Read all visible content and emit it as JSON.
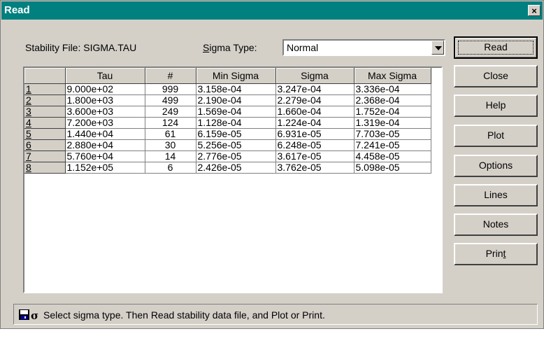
{
  "window": {
    "title": "Read",
    "close_label": "×"
  },
  "stability_file_label": "Stability File: SIGMA.TAU",
  "sigma_type": {
    "label_first": "S",
    "label_rest": "igma Type:",
    "value": "Normal"
  },
  "buttons": [
    {
      "id": "read",
      "label": "Read"
    },
    {
      "id": "close",
      "label": "Close"
    },
    {
      "id": "help",
      "label": "Help"
    },
    {
      "id": "plot",
      "label": "Plot"
    },
    {
      "id": "options",
      "label": "Options"
    },
    {
      "id": "lines",
      "label": "Lines"
    },
    {
      "id": "notes",
      "label": "Notes"
    },
    {
      "id": "print",
      "label_a": "Prin",
      "label_b": "t"
    }
  ],
  "table": {
    "columns": [
      "",
      "Tau",
      "#",
      "Min Sigma",
      "Sigma",
      "Max Sigma"
    ],
    "rows": [
      [
        "1",
        "9.000e+02",
        "999",
        "3.158e-04",
        "3.247e-04",
        "3.336e-04"
      ],
      [
        "2",
        "1.800e+03",
        "499",
        "2.190e-04",
        "2.279e-04",
        "2.368e-04"
      ],
      [
        "3",
        "3.600e+03",
        "249",
        "1.569e-04",
        "1.660e-04",
        "1.752e-04"
      ],
      [
        "4",
        "7.200e+03",
        "124",
        "1.128e-04",
        "1.224e-04",
        "1.319e-04"
      ],
      [
        "5",
        "1.440e+04",
        "61",
        "6.159e-05",
        "6.931e-05",
        "7.703e-05"
      ],
      [
        "6",
        "2.880e+04",
        "30",
        "5.256e-05",
        "6.248e-05",
        "7.241e-05"
      ],
      [
        "7",
        "5.760e+04",
        "14",
        "2.776e-05",
        "3.617e-05",
        "4.458e-05"
      ],
      [
        "8",
        "1.152e+05",
        "6",
        "2.426e-05",
        "3.762e-05",
        "5.098e-05"
      ]
    ]
  },
  "status": {
    "icon": "floppy-sigma-icon",
    "text": "Select sigma type.  Then Read stability data file, and Plot or Print."
  }
}
